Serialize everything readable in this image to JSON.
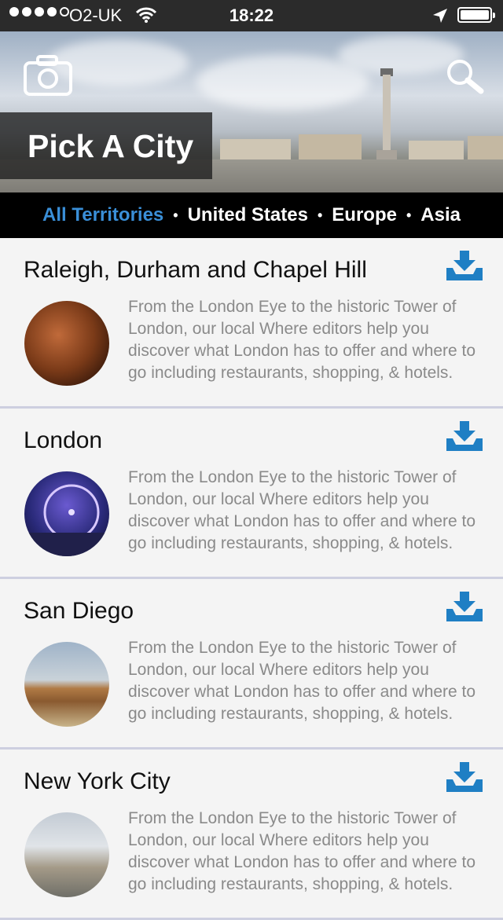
{
  "status_bar": {
    "carrier": "O2-UK",
    "time": "18:22"
  },
  "header": {
    "title": "Pick A City"
  },
  "tabs": [
    {
      "label": "All Territories",
      "active": true
    },
    {
      "label": "United States",
      "active": false
    },
    {
      "label": "Europe",
      "active": false
    },
    {
      "label": "Asia",
      "active": false
    }
  ],
  "tab_separator": "•",
  "cities": [
    {
      "name": "Raleigh, Durham and Chapel Hill",
      "description": "From the London Eye to the historic Tower of London, our local Where editors help you discover what London has to offer and where to go including restaurants, shopping, & hotels."
    },
    {
      "name": "London",
      "description": "From the London Eye to the historic Tower of London, our local Where editors help you discover what London has to offer and where to go including restaurants, shopping, & hotels."
    },
    {
      "name": "San Diego",
      "description": "From the London Eye to the historic Tower of London, our local Where editors help you discover what London has to offer and where to go including restaurants, shopping, & hotels."
    },
    {
      "name": "New York City",
      "description": "From the London Eye to the historic Tower of London, our local Where editors help you discover what London has to offer and where to go including restaurants, shopping, & hotels."
    }
  ],
  "colors": {
    "accent": "#3a8fd8",
    "download_icon": "#1f7fc4",
    "tab_bar_bg": "#000000",
    "divider": "#cdcfe0"
  },
  "icons": {
    "camera": "camera-icon",
    "search": "search-icon",
    "download": "download-icon",
    "wifi": "wifi-icon",
    "location": "location-arrow-icon",
    "battery": "battery-icon"
  }
}
